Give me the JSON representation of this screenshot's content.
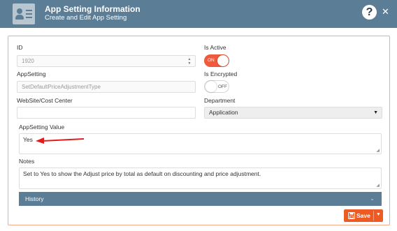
{
  "header": {
    "title": "App Setting Information",
    "subtitle": "Create and Edit App Setting",
    "help_icon": "question-circle-icon",
    "help_symbol": "?",
    "close_icon": "close-icon",
    "close_symbol": "✕",
    "app_icon": "id-card-icon",
    "background_color": "#5b7d96"
  },
  "form": {
    "id": {
      "label": "ID",
      "value": "1920"
    },
    "is_active": {
      "label": "Is Active",
      "state": "ON",
      "checked": true
    },
    "app_setting": {
      "label": "AppSetting",
      "value": "SetDefaultPriceAdjustmentType"
    },
    "is_encrypted": {
      "label": "Is Encrypted",
      "state": "OFF",
      "checked": false
    },
    "website_cost_center": {
      "label": "WebSite/Cost Center",
      "value": ""
    },
    "department": {
      "label": "Department",
      "selected": "Application"
    },
    "app_setting_value": {
      "label": "AppSetting Value",
      "value": "Yes"
    },
    "notes": {
      "label": "Notes",
      "value": "Set to Yes to show the Adjust price by total as default on discounting and price adjustment."
    }
  },
  "history": {
    "label": "History",
    "icon": "chevron-down-icon"
  },
  "actions": {
    "save_label": "Save",
    "save_icon": "floppy-disk-icon",
    "dropdown_icon": "caret-down-icon"
  },
  "colors": {
    "accent": "#ee5a24",
    "toggle_on": "#ee5a3e",
    "panel_border": "#f4a98a",
    "annotation_arrow": "#e31b1b"
  }
}
